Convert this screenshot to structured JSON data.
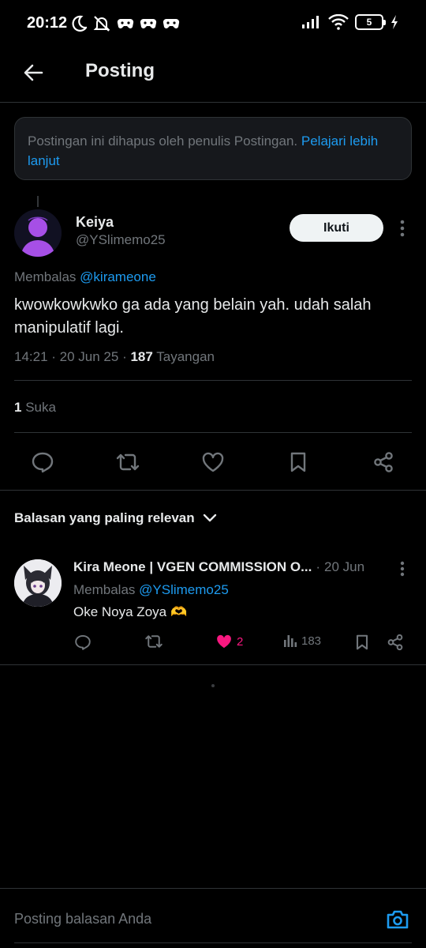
{
  "status_bar": {
    "time": "20:12",
    "battery": "5",
    "icons": [
      "moon-icon",
      "muted-bell-icon",
      "game-controller-icon",
      "game-controller-icon",
      "game-controller-icon",
      "signal-icon",
      "wifi-icon",
      "battery-icon",
      "charging-icon"
    ]
  },
  "header": {
    "title": "Posting",
    "back_icon": "arrow-left-icon"
  },
  "notice": {
    "text": "Postingan ini dihapus oleh penulis Postingan.",
    "link": "Pelajari lebih lanjut"
  },
  "post": {
    "author_name": "Keiya",
    "author_handle": "@YSlimemo25",
    "follow_label": "Ikuti",
    "replying_prefix": "Membalas",
    "replying_to": "@kirameone",
    "text": "kwowkowkwko ga ada yang belain yah. udah salah manipulatif lagi.",
    "time": "14:21",
    "date": "20 Jun 25",
    "views_count": "187",
    "views_label": "Tayangan",
    "likes_count": "1",
    "likes_label": "Suka"
  },
  "actions": [
    "reply-icon",
    "repost-icon",
    "like-icon",
    "bookmark-icon",
    "share-icon"
  ],
  "replies_sort": {
    "label": "Balasan yang paling relevan"
  },
  "reply": {
    "author_name": "Kira Meone | VGEN COMMISSION O...",
    "date": "20 Jun",
    "replying_prefix": "Membalas",
    "replying_to": "@YSlimemo25",
    "text": "Oke Noya Zoya",
    "emoji": "🫶",
    "likes": "2",
    "views": "183"
  },
  "composer": {
    "placeholder": "Posting balasan Anda"
  },
  "colors": {
    "background": "#000000",
    "text_primary": "#e7e9ea",
    "text_secondary": "#71767b",
    "accent": "#1d9bf0",
    "like": "#f91880",
    "border": "#2f3336"
  }
}
